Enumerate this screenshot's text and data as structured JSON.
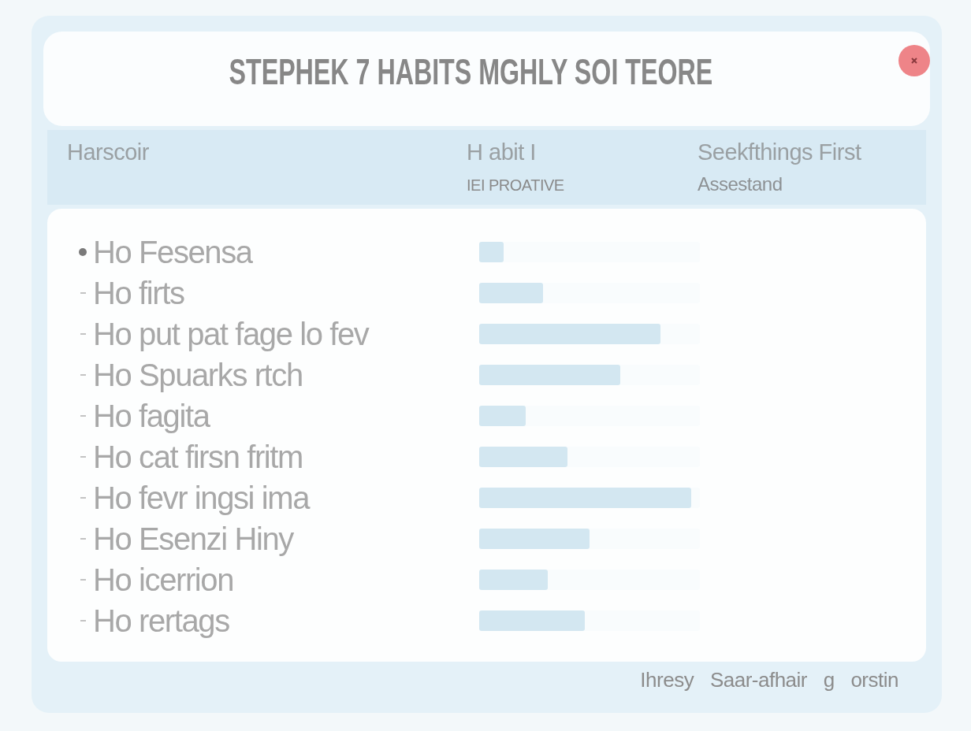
{
  "window": {
    "title": "STEPHEK 7 HABITS MGHLY SOI TEORE"
  },
  "table": {
    "columns": [
      {
        "label": "Harscoir"
      },
      {
        "label": "H abit I",
        "sublabel": "IEI PROATIVE"
      },
      {
        "label": "Seekfthings First",
        "sublabel": "Assestand"
      }
    ],
    "rows": [
      {
        "label": "Ho Fesensa",
        "selected": true,
        "level": 0.11
      },
      {
        "label": "Ho firts",
        "selected": false,
        "level": 0.29
      },
      {
        "label": "Ho put pat fage lo fev",
        "selected": false,
        "level": 0.82
      },
      {
        "label": "Ho Spuarks rtch",
        "selected": false,
        "level": 0.64
      },
      {
        "label": "Ho fagita",
        "selected": false,
        "level": 0.21
      },
      {
        "label": "Ho cat firsn fritm",
        "selected": false,
        "level": 0.4
      },
      {
        "label": "Ho fevr ingsi ima",
        "selected": false,
        "level": 0.96
      },
      {
        "label": "Ho Esenzi Hiny",
        "selected": false,
        "level": 0.5
      },
      {
        "label": "Ho icerrion",
        "selected": false,
        "level": 0.31
      },
      {
        "label": "Ho rertags",
        "selected": false,
        "level": 0.48
      }
    ]
  },
  "footer": {
    "note": "Ihresy Saar-afhair g orstin"
  }
}
